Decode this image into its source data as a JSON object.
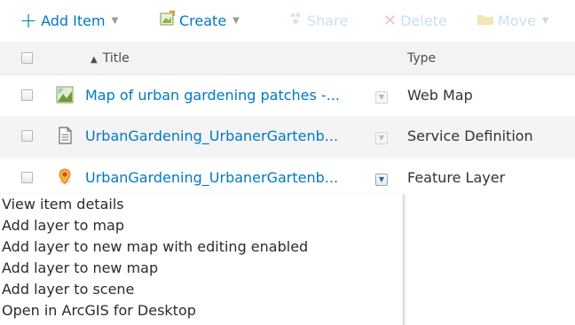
{
  "toolbar": {
    "add_item": "Add Item",
    "create": "Create",
    "share": "Share",
    "delete": "Delete",
    "move": "Move"
  },
  "table": {
    "header": {
      "title": "Title",
      "type": "Type"
    },
    "rows": [
      {
        "title": "Map of urban gardening patches -...",
        "type": "Web Map",
        "icon": "web-map-icon"
      },
      {
        "title": "UrbanGardening_UrbanerGartenb...",
        "type": "Service Definition",
        "icon": "document-icon"
      },
      {
        "title": "UrbanGardening_UrbanerGartenb...",
        "type": "Feature Layer",
        "icon": "feature-layer-icon"
      }
    ],
    "partial_text": "1"
  },
  "menu": {
    "items": [
      "View item details",
      "Add layer to map",
      "Add layer to new map with editing enabled",
      "Add layer to new map",
      "Add layer to scene",
      "Open in ArcGIS for Desktop"
    ]
  },
  "colors": {
    "link": "#0079c1",
    "disabled": "#c9dff0",
    "header_bg": "#f3f3f3",
    "alt_row_bg": "#f4f4f4"
  }
}
